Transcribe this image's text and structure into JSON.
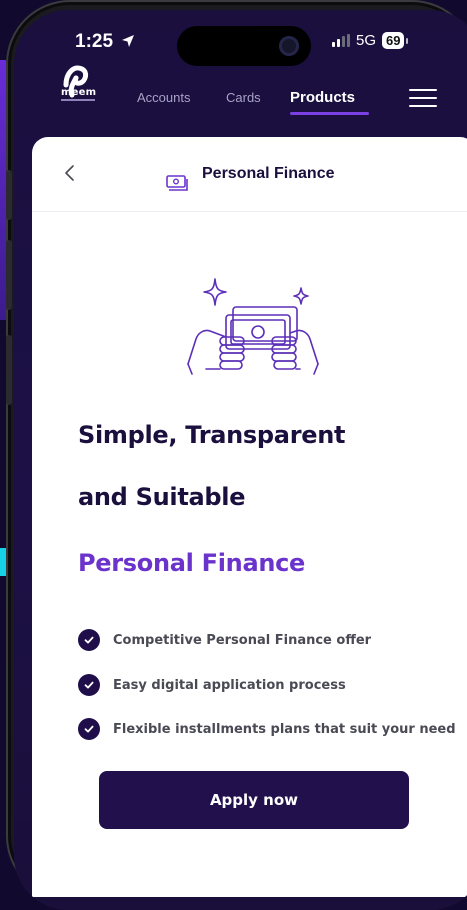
{
  "status_bar": {
    "time": "1:25",
    "network": "5G",
    "battery": "69"
  },
  "brand": {
    "logo_text": "meem"
  },
  "nav": {
    "tabs": [
      {
        "label": "Accounts",
        "active": false
      },
      {
        "label": "Cards",
        "active": false
      },
      {
        "label": "Products",
        "active": true
      }
    ]
  },
  "page": {
    "title": "Personal Finance",
    "headline_line1": "Simple, Transparent",
    "headline_line2": "and Suitable",
    "headline_accent": "Personal Finance",
    "features": [
      "Competitive Personal Finance offer",
      "Easy digital application process",
      "Flexible installments plans that suit your need"
    ],
    "cta_label": "Apply now"
  },
  "colors": {
    "background": "#1a0f3d",
    "accent": "#6a33cc",
    "primary_dark": "#22104d",
    "nav_active_underline": "#7b3fe4"
  },
  "icons": [
    "location-arrow-icon",
    "camera-icon",
    "signal-icon",
    "battery-icon",
    "menu-icon",
    "chevron-left-icon",
    "cash-icon",
    "finance-illustration-icon",
    "check-icon"
  ]
}
